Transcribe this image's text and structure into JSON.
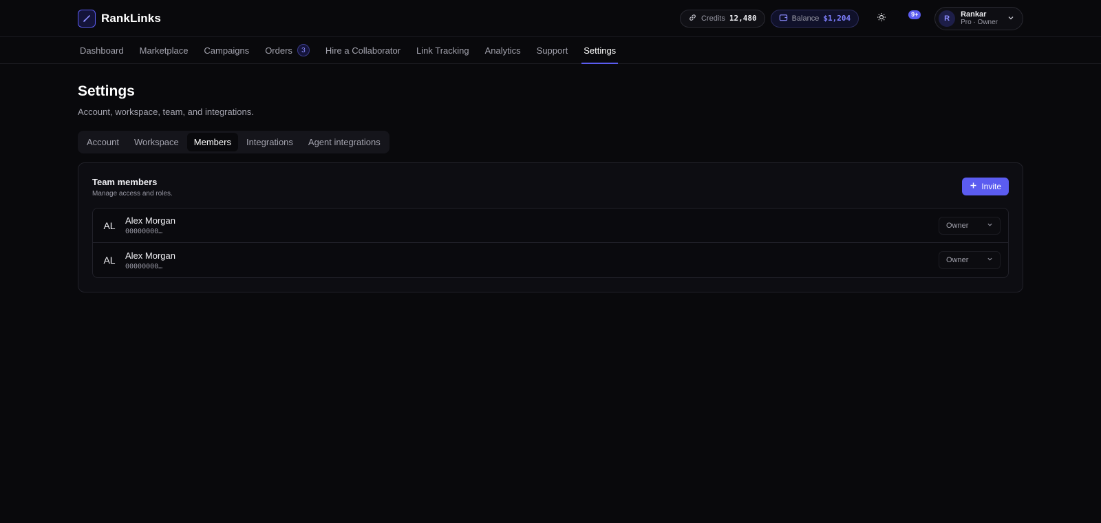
{
  "app": {
    "name": "RankLinks",
    "accent": "#5b5cf0"
  },
  "header": {
    "credits": {
      "label": "Credits",
      "value": "12,480"
    },
    "balance": {
      "label": "Balance",
      "value": "$1,204"
    },
    "notifications": {
      "count": "9+"
    },
    "user": {
      "initial": "R",
      "name": "Rankar",
      "role": "Pro · Owner"
    }
  },
  "nav": {
    "items": [
      {
        "label": "Dashboard"
      },
      {
        "label": "Marketplace"
      },
      {
        "label": "Campaigns"
      },
      {
        "label": "Orders",
        "badge": "3"
      },
      {
        "label": "Hire a Collaborator"
      },
      {
        "label": "Link Tracking"
      },
      {
        "label": "Analytics"
      },
      {
        "label": "Support"
      },
      {
        "label": "Settings",
        "active": true
      }
    ]
  },
  "page": {
    "title": "Settings",
    "subtitle": "Account, workspace, team, and integrations."
  },
  "tabs": [
    {
      "label": "Account"
    },
    {
      "label": "Workspace"
    },
    {
      "label": "Members",
      "active": true
    },
    {
      "label": "Integrations"
    },
    {
      "label": "Agent integrations"
    }
  ],
  "team": {
    "title": "Team members",
    "subtitle": "Manage access and roles.",
    "invite_label": "Invite",
    "members": [
      {
        "initials": "AL",
        "name": "Alex Morgan",
        "id": "00000000…",
        "role": "Owner"
      },
      {
        "initials": "AL",
        "name": "Alex Morgan",
        "id": "00000000…",
        "role": "Owner"
      }
    ]
  }
}
